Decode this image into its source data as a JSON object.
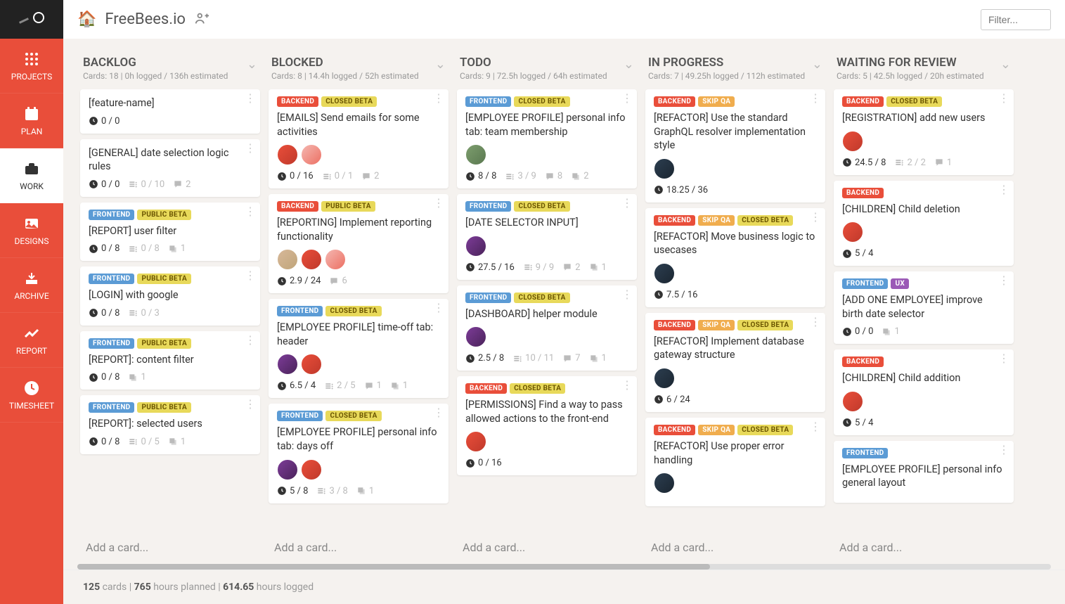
{
  "header": {
    "icon": "🏠",
    "title": "FreeBees.io",
    "filter_placeholder": "Filter..."
  },
  "nav": [
    {
      "id": "projects",
      "label": "PROJECTS",
      "active": false
    },
    {
      "id": "plan",
      "label": "PLAN",
      "active": false
    },
    {
      "id": "work",
      "label": "WORK",
      "active": true
    },
    {
      "id": "designs",
      "label": "DESIGNS",
      "active": false
    },
    {
      "id": "archive",
      "label": "ARCHIVE",
      "active": false
    },
    {
      "id": "report",
      "label": "REPORT",
      "active": false
    },
    {
      "id": "timesheet",
      "label": "TIMESHEET",
      "active": false
    }
  ],
  "columns": [
    {
      "title": "BACKLOG",
      "sub": "Cards: 18 | 0h logged / 136h estimated",
      "add": "Add a card...",
      "cards": [
        {
          "tags": [],
          "title": "[feature-name]",
          "avatars": [],
          "stats": [
            {
              "t": "clock",
              "v": "0 / 0"
            }
          ]
        },
        {
          "tags": [],
          "title": "[GENERAL] date selection logic rules",
          "avatars": [],
          "stats": [
            {
              "t": "clock",
              "v": "0 / 0"
            },
            {
              "t": "check",
              "v": "0 / 10",
              "muted": true
            },
            {
              "t": "chat",
              "v": "2",
              "muted": true
            }
          ]
        },
        {
          "tags": [
            {
              "c": "frontend",
              "l": "FRONTEND"
            },
            {
              "c": "publicbeta",
              "l": "PUBLIC BETA"
            }
          ],
          "title": "[REPORT] user filter",
          "avatars": [],
          "stats": [
            {
              "t": "clock",
              "v": "0 / 8"
            },
            {
              "t": "check",
              "v": "0 / 8",
              "muted": true
            },
            {
              "t": "stack",
              "v": "1",
              "muted": true
            }
          ]
        },
        {
          "tags": [
            {
              "c": "frontend",
              "l": "FRONTEND"
            },
            {
              "c": "publicbeta",
              "l": "PUBLIC BETA"
            }
          ],
          "title": "[LOGIN] with google",
          "avatars": [],
          "stats": [
            {
              "t": "clock",
              "v": "0 / 8"
            },
            {
              "t": "check",
              "v": "0 / 3",
              "muted": true
            }
          ]
        },
        {
          "tags": [
            {
              "c": "frontend",
              "l": "FRONTEND"
            },
            {
              "c": "publicbeta",
              "l": "PUBLIC BETA"
            }
          ],
          "title": "[REPORT]: content filter",
          "avatars": [],
          "stats": [
            {
              "t": "clock",
              "v": "0 / 8"
            },
            {
              "t": "stack",
              "v": "1",
              "muted": true
            }
          ]
        },
        {
          "tags": [
            {
              "c": "frontend",
              "l": "FRONTEND"
            },
            {
              "c": "publicbeta",
              "l": "PUBLIC BETA"
            }
          ],
          "title": "[REPORT]: selected users",
          "avatars": [],
          "stats": [
            {
              "t": "clock",
              "v": "0 / 8"
            },
            {
              "t": "check",
              "v": "0 / 5",
              "muted": true
            },
            {
              "t": "stack",
              "v": "1",
              "muted": true
            }
          ]
        }
      ]
    },
    {
      "title": "BLOCKED",
      "sub": "Cards: 8 | 14.4h logged / 52h estimated",
      "add": "Add a card...",
      "cards": [
        {
          "tags": [
            {
              "c": "backend",
              "l": "BACKEND"
            },
            {
              "c": "closedbeta",
              "l": "CLOSED BETA"
            }
          ],
          "title": "[EMAILS] Send emails for some activities",
          "avatars": [
            "av-red",
            "av-pink"
          ],
          "stats": [
            {
              "t": "clock",
              "v": "0 / 16"
            },
            {
              "t": "check",
              "v": "0 / 1",
              "muted": true
            },
            {
              "t": "chat",
              "v": "2",
              "muted": true
            }
          ]
        },
        {
          "tags": [
            {
              "c": "backend",
              "l": "BACKEND"
            },
            {
              "c": "publicbeta",
              "l": "PUBLIC BETA"
            }
          ],
          "title": "[REPORTING] Implement reporting functionality",
          "avatars": [
            "av-tan",
            "av-red",
            "av-pink"
          ],
          "stats": [
            {
              "t": "clock",
              "v": "2.9 / 24"
            },
            {
              "t": "chat",
              "v": "6",
              "muted": true
            }
          ]
        },
        {
          "tags": [
            {
              "c": "frontend",
              "l": "FRONTEND"
            },
            {
              "c": "closedbeta",
              "l": "CLOSED BETA"
            }
          ],
          "title": "[EMPLOYEE PROFILE] time-off tab: header",
          "avatars": [
            "av-purple",
            "av-red"
          ],
          "stats": [
            {
              "t": "clock",
              "v": "6.5 / 4"
            },
            {
              "t": "check",
              "v": "2 / 5",
              "muted": true
            },
            {
              "t": "chat",
              "v": "1",
              "muted": true
            },
            {
              "t": "stack",
              "v": "1",
              "muted": true
            }
          ]
        },
        {
          "tags": [
            {
              "c": "frontend",
              "l": "FRONTEND"
            },
            {
              "c": "closedbeta",
              "l": "CLOSED BETA"
            }
          ],
          "title": "[EMPLOYEE PROFILE] personal info tab: days off",
          "avatars": [
            "av-purple",
            "av-red"
          ],
          "stats": [
            {
              "t": "clock",
              "v": "5 / 8"
            },
            {
              "t": "check",
              "v": "3 / 8",
              "muted": true
            },
            {
              "t": "stack",
              "v": "1",
              "muted": true
            }
          ]
        }
      ]
    },
    {
      "title": "TODO",
      "sub": "Cards: 9 | 72.5h logged / 64h estimated",
      "add": "Add a card...",
      "cards": [
        {
          "tags": [
            {
              "c": "frontend",
              "l": "FRONTEND"
            },
            {
              "c": "closedbeta",
              "l": "CLOSED BETA"
            }
          ],
          "title": "[EMPLOYEE PROFILE] personal info tab: team membership",
          "avatars": [
            "av-green"
          ],
          "stats": [
            {
              "t": "clock",
              "v": "8 / 8"
            },
            {
              "t": "check",
              "v": "3 / 9",
              "muted": true
            },
            {
              "t": "chat",
              "v": "8",
              "muted": true
            },
            {
              "t": "stack",
              "v": "2",
              "muted": true
            }
          ]
        },
        {
          "tags": [
            {
              "c": "frontend",
              "l": "FRONTEND"
            },
            {
              "c": "closedbeta",
              "l": "CLOSED BETA"
            }
          ],
          "title": "[DATE SELECTOR INPUT]",
          "avatars": [
            "av-purple"
          ],
          "stats": [
            {
              "t": "clock",
              "v": "27.5 / 16"
            },
            {
              "t": "check",
              "v": "9 / 9",
              "muted": true
            },
            {
              "t": "chat",
              "v": "2",
              "muted": true
            },
            {
              "t": "stack",
              "v": "1",
              "muted": true
            }
          ]
        },
        {
          "tags": [
            {
              "c": "frontend",
              "l": "FRONTEND"
            },
            {
              "c": "closedbeta",
              "l": "CLOSED BETA"
            }
          ],
          "title": "[DASHBOARD] helper module",
          "avatars": [
            "av-purple"
          ],
          "stats": [
            {
              "t": "clock",
              "v": "2.5 / 8"
            },
            {
              "t": "check",
              "v": "10 / 11",
              "muted": true
            },
            {
              "t": "chat",
              "v": "7",
              "muted": true
            },
            {
              "t": "stack",
              "v": "1",
              "muted": true
            }
          ]
        },
        {
          "tags": [
            {
              "c": "backend",
              "l": "BACKEND"
            },
            {
              "c": "closedbeta",
              "l": "CLOSED BETA"
            }
          ],
          "title": "[PERMISSIONS] Find a way to pass allowed actions to the front-end",
          "avatars": [
            "av-red"
          ],
          "stats": [
            {
              "t": "clock",
              "v": "0 / 16"
            }
          ]
        }
      ]
    },
    {
      "title": "IN PROGRESS",
      "sub": "Cards: 7 | 49.25h logged / 112h estimated",
      "add": "Add a card...",
      "cards": [
        {
          "tags": [
            {
              "c": "backend",
              "l": "BACKEND"
            },
            {
              "c": "skipqa",
              "l": "SKIP QA"
            }
          ],
          "title": "[REFACTOR] Use the standard GraphQL resolver implementation style",
          "avatars": [
            "av-dark"
          ],
          "stats": [
            {
              "t": "clock",
              "v": "18.25 / 36"
            }
          ]
        },
        {
          "tags": [
            {
              "c": "backend",
              "l": "BACKEND"
            },
            {
              "c": "skipqa",
              "l": "SKIP QA"
            },
            {
              "c": "closedbeta",
              "l": "CLOSED BETA"
            }
          ],
          "title": "[REFACTOR] Move business logic to usecases",
          "avatars": [
            "av-dark"
          ],
          "stats": [
            {
              "t": "clock",
              "v": "7.5 / 16"
            }
          ]
        },
        {
          "tags": [
            {
              "c": "backend",
              "l": "BACKEND"
            },
            {
              "c": "skipqa",
              "l": "SKIP QA"
            },
            {
              "c": "closedbeta",
              "l": "CLOSED BETA"
            }
          ],
          "title": "[REFACTOR] Implement database gateway structure",
          "avatars": [
            "av-dark"
          ],
          "stats": [
            {
              "t": "clock",
              "v": "6 / 24"
            }
          ]
        },
        {
          "tags": [
            {
              "c": "backend",
              "l": "BACKEND"
            },
            {
              "c": "skipqa",
              "l": "SKIP QA"
            },
            {
              "c": "closedbeta",
              "l": "CLOSED BETA"
            }
          ],
          "title": "[REFACTOR] Use proper error handling",
          "avatars": [
            "av-dark"
          ],
          "stats": []
        }
      ]
    },
    {
      "title": "WAITING FOR REVIEW",
      "sub": "Cards: 5 | 42.5h logged / 20h estimated",
      "add": "Add a card...",
      "cards": [
        {
          "tags": [
            {
              "c": "backend",
              "l": "BACKEND"
            },
            {
              "c": "closedbeta",
              "l": "CLOSED BETA"
            }
          ],
          "title": "[REGISTRATION] add new users",
          "avatars": [
            "av-red"
          ],
          "stats": [
            {
              "t": "clock",
              "v": "24.5 / 8"
            },
            {
              "t": "check",
              "v": "2 / 2",
              "muted": true
            },
            {
              "t": "chat",
              "v": "1",
              "muted": true
            }
          ]
        },
        {
          "tags": [
            {
              "c": "backend",
              "l": "BACKEND"
            }
          ],
          "title": "[CHILDREN] Child deletion",
          "avatars": [
            "av-red"
          ],
          "stats": [
            {
              "t": "clock",
              "v": "5 / 4"
            }
          ]
        },
        {
          "tags": [
            {
              "c": "frontend",
              "l": "FRONTEND"
            },
            {
              "c": "ux",
              "l": "UX"
            }
          ],
          "title": "[ADD ONE EMPLOYEE] improve birth date selector",
          "avatars": [],
          "stats": [
            {
              "t": "clock",
              "v": "0 / 0"
            },
            {
              "t": "stack",
              "v": "1",
              "muted": true
            }
          ]
        },
        {
          "tags": [
            {
              "c": "backend",
              "l": "BACKEND"
            }
          ],
          "title": "[CHILDREN] Child addition",
          "avatars": [
            "av-red"
          ],
          "stats": [
            {
              "t": "clock",
              "v": "5 / 4"
            }
          ]
        },
        {
          "tags": [
            {
              "c": "frontend",
              "l": "FRONTEND"
            }
          ],
          "title": "[EMPLOYEE PROFILE] personal info general layout",
          "avatars": [],
          "stats": []
        }
      ]
    }
  ],
  "footer": {
    "cards": "125",
    "cards_lbl": " cards | ",
    "planned": "765",
    "planned_lbl": " hours planned | ",
    "logged": "614.65",
    "logged_lbl": " hours logged"
  }
}
